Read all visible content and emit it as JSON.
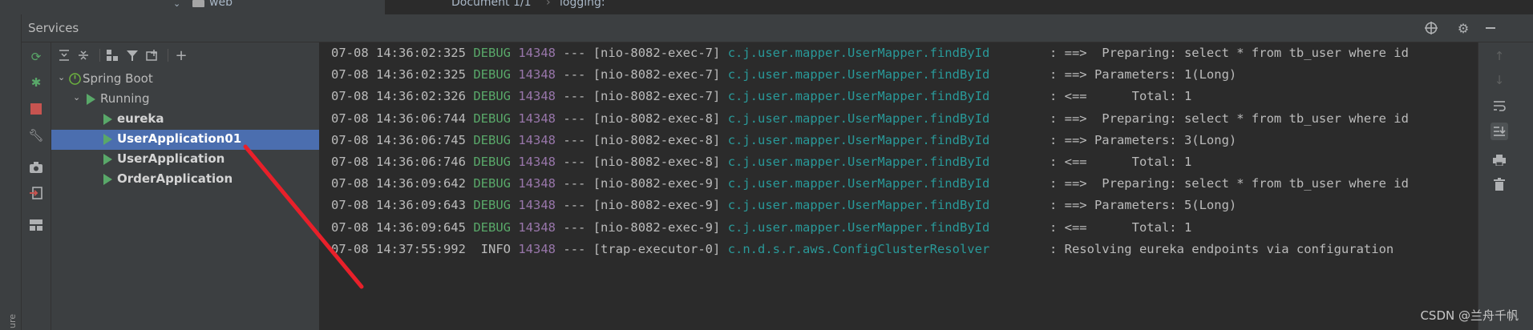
{
  "top_strip": {
    "folder_label": "web",
    "breadcrumb_doc": "Document 1/1",
    "breadcrumb_sep": "›",
    "breadcrumb_key": "logging:"
  },
  "side_stripe_label": "ure",
  "services": {
    "title": "Services",
    "header_icons": [
      "crosshair-icon",
      "gear-icon",
      "minimize-icon"
    ]
  },
  "tool_column_icons": [
    "rerun-icon",
    "debug-icon",
    "stop-icon",
    "wrench-icon",
    "camera-icon",
    "exit-icon",
    "layout-icon"
  ],
  "tree_toolbar_icons": [
    "expand-all-icon",
    "collapse-all-icon",
    "group-icon",
    "filter-icon",
    "new-service-icon",
    "add-icon"
  ],
  "tree": [
    {
      "label": "Spring Boot",
      "level": 0,
      "expanded": true,
      "kind": "group"
    },
    {
      "label": "Running",
      "level": 1,
      "expanded": true,
      "kind": "status"
    },
    {
      "label": "eureka",
      "level": 2,
      "kind": "app",
      "selected": false
    },
    {
      "label": "UserApplication01",
      "level": 2,
      "kind": "app",
      "selected": true
    },
    {
      "label": "UserApplication",
      "level": 2,
      "kind": "app",
      "selected": false
    },
    {
      "label": "OrderApplication",
      "level": 2,
      "kind": "app",
      "selected": false
    }
  ],
  "log_lines": [
    {
      "time": "07-08 14:36:02:325",
      "level": "DEBUG",
      "pid": "14348",
      "sep": "---",
      "thread": "[nio-8082-exec-7]",
      "logger": "c.j.user.mapper.UserMapper.findById",
      "message": ": ==>  Preparing: select * from tb_user where id"
    },
    {
      "time": "07-08 14:36:02:325",
      "level": "DEBUG",
      "pid": "14348",
      "sep": "---",
      "thread": "[nio-8082-exec-7]",
      "logger": "c.j.user.mapper.UserMapper.findById",
      "message": ": ==> Parameters: 1(Long)"
    },
    {
      "time": "07-08 14:36:02:326",
      "level": "DEBUG",
      "pid": "14348",
      "sep": "---",
      "thread": "[nio-8082-exec-7]",
      "logger": "c.j.user.mapper.UserMapper.findById",
      "message": ": <==      Total: 1"
    },
    {
      "time": "07-08 14:36:06:744",
      "level": "DEBUG",
      "pid": "14348",
      "sep": "---",
      "thread": "[nio-8082-exec-8]",
      "logger": "c.j.user.mapper.UserMapper.findById",
      "message": ": ==>  Preparing: select * from tb_user where id"
    },
    {
      "time": "07-08 14:36:06:745",
      "level": "DEBUG",
      "pid": "14348",
      "sep": "---",
      "thread": "[nio-8082-exec-8]",
      "logger": "c.j.user.mapper.UserMapper.findById",
      "message": ": ==> Parameters: 3(Long)"
    },
    {
      "time": "07-08 14:36:06:746",
      "level": "DEBUG",
      "pid": "14348",
      "sep": "---",
      "thread": "[nio-8082-exec-8]",
      "logger": "c.j.user.mapper.UserMapper.findById",
      "message": ": <==      Total: 1"
    },
    {
      "time": "07-08 14:36:09:642",
      "level": "DEBUG",
      "pid": "14348",
      "sep": "---",
      "thread": "[nio-8082-exec-9]",
      "logger": "c.j.user.mapper.UserMapper.findById",
      "message": ": ==>  Preparing: select * from tb_user where id"
    },
    {
      "time": "07-08 14:36:09:643",
      "level": "DEBUG",
      "pid": "14348",
      "sep": "---",
      "thread": "[nio-8082-exec-9]",
      "logger": "c.j.user.mapper.UserMapper.findById",
      "message": ": ==> Parameters: 5(Long)"
    },
    {
      "time": "07-08 14:36:09:645",
      "level": "DEBUG",
      "pid": "14348",
      "sep": "---",
      "thread": "[nio-8082-exec-9]",
      "logger": "c.j.user.mapper.UserMapper.findById",
      "message": ": <==      Total: 1"
    },
    {
      "time": "07-08 14:37:55:992",
      "level": " INFO",
      "pid": "14348",
      "sep": "---",
      "thread": "[trap-executor-0]",
      "logger": "c.n.d.s.r.aws.ConfigClusterResolver",
      "message": ": Resolving eureka endpoints via configuration"
    }
  ],
  "right_toolbar_icons": [
    "scroll-up-icon",
    "scroll-down-icon",
    "soft-wrap-icon",
    "scroll-to-end-icon",
    "print-icon",
    "trash-icon"
  ],
  "watermark": "CSDN @兰舟千帆",
  "colors": {
    "debug": "#59a869",
    "pid": "#9876aa",
    "logger": "#299999",
    "selection": "#4b6eaf",
    "annotation_arrow": "#e8202a"
  }
}
